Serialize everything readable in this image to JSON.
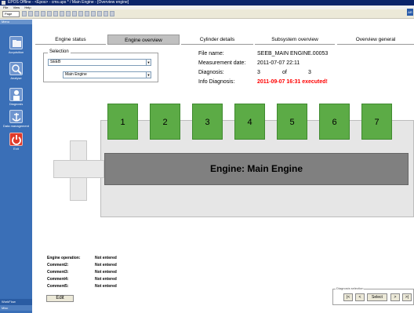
{
  "window": {
    "title": "EPOS Offline - <Epos> - cms.ups * / Main Engine - [Overview engine]",
    "menu": [
      "File",
      "View",
      "Help"
    ],
    "page_label": "Page",
    "corner_label": "AR"
  },
  "sidebar": {
    "header": "Menu",
    "items": [
      {
        "label": "Acquisition",
        "icon": "folder-icon"
      },
      {
        "label": "Analyse",
        "icon": "magnifier-icon"
      },
      {
        "label": "Diagnosis",
        "icon": "person-icon"
      },
      {
        "label": "Data management",
        "icon": "anchor-icon"
      },
      {
        "label": "Exit",
        "icon": "power-icon"
      }
    ],
    "footer1": "WorkFlow",
    "footer2": "Misc"
  },
  "tabs": [
    {
      "label": "Engine status"
    },
    {
      "label": "Engine overview",
      "active": true
    },
    {
      "label": "Cylinder details"
    },
    {
      "label": "Subsystem overview"
    },
    {
      "label": "Overview general"
    }
  ],
  "selection": {
    "legend": "Selection",
    "ship": "SEEB",
    "engine": "Main Engine"
  },
  "info": {
    "file_name_label": "File name:",
    "file_name": "SEEB_MAIN ENGINE.00053",
    "measurement_date_label": "Measurement date:",
    "measurement_date": "2011-07-07 22:11",
    "diagnosis_label": "Diagnosis:",
    "diagnosis_current": "3",
    "diagnosis_of": "of",
    "diagnosis_total": "3",
    "info_diagnosis_label": "Info Diagnosis:",
    "info_diagnosis": "2011-09-07 16:31 executed!"
  },
  "engine": {
    "cylinders": [
      "1",
      "2",
      "3",
      "4",
      "5",
      "6",
      "7"
    ],
    "label": "Engine: Main Engine",
    "cylinder_color": "#5cab46",
    "engine_color": "#808080"
  },
  "comments": [
    {
      "label": "Engine operation:",
      "value": "Not entered"
    },
    {
      "label": "Comment2:",
      "value": "Not entered"
    },
    {
      "label": "Comment3:",
      "value": "Not entered"
    },
    {
      "label": "Comment4:",
      "value": "Not entered"
    },
    {
      "label": "Comment5:",
      "value": "Not entered"
    }
  ],
  "edit_label": "Edit",
  "diag_selection": {
    "legend": "Diagnosis selection",
    "first": "|<",
    "prev": "<",
    "select": "Select",
    "next": ">",
    "last": ">|"
  }
}
